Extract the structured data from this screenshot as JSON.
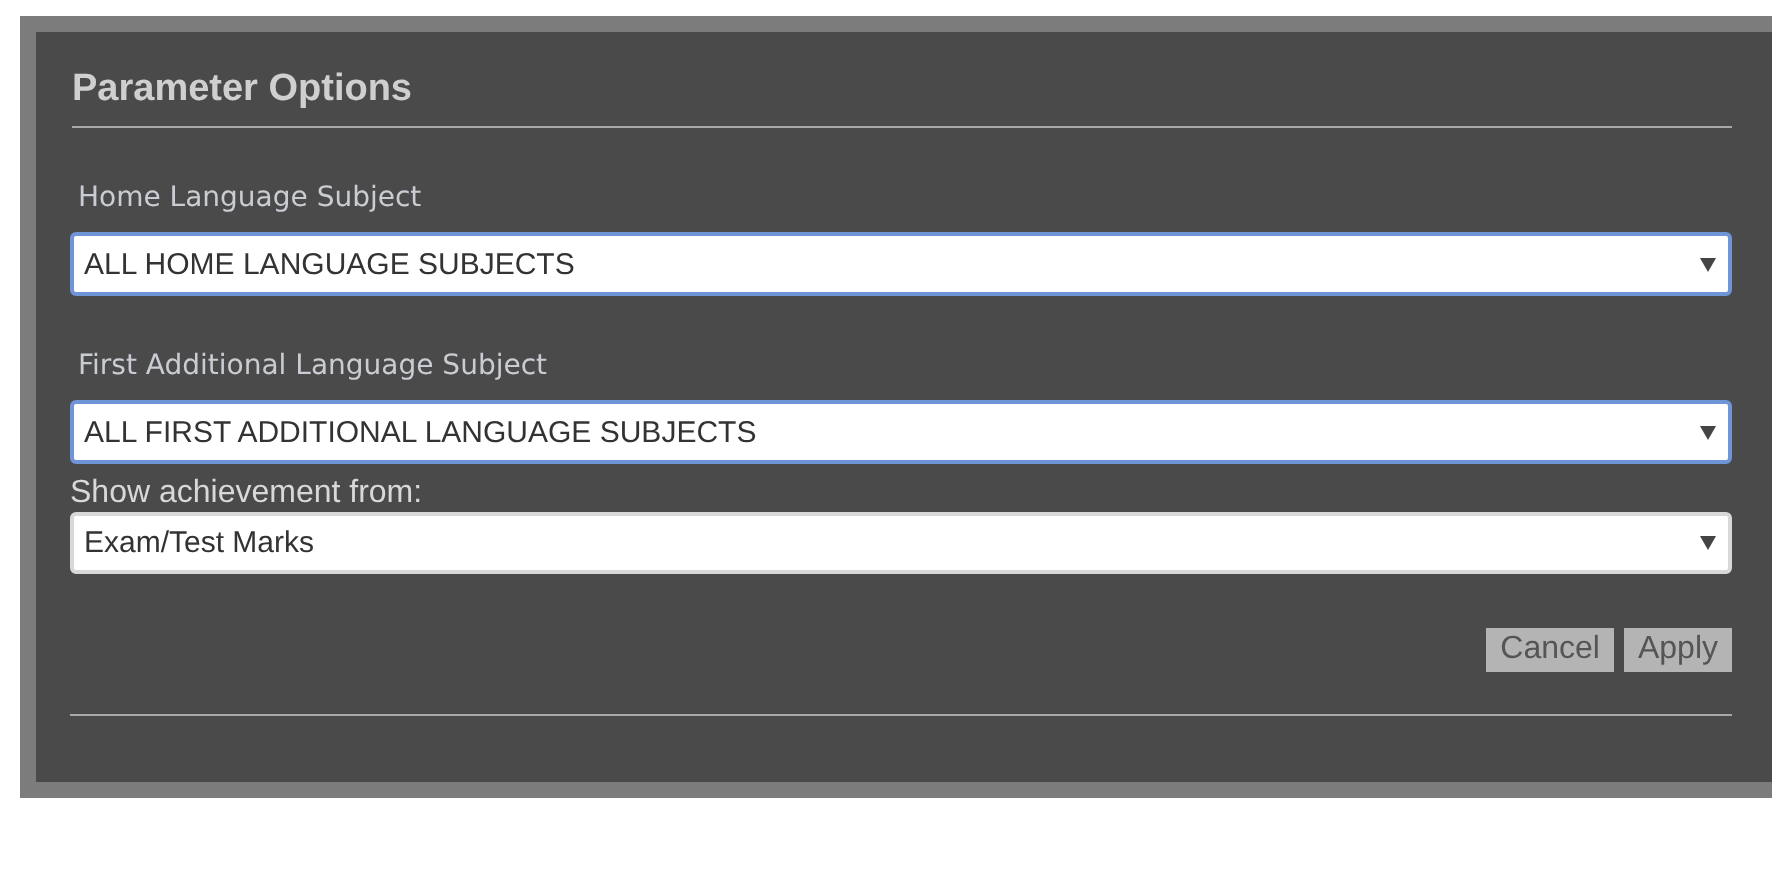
{
  "dialog": {
    "title": "Parameter Options",
    "fields": [
      {
        "label": "Home Language Subject",
        "value": "ALL HOME LANGUAGE SUBJECTS",
        "focused": true,
        "kind": "styled"
      },
      {
        "label": "First Additional Language Subject",
        "value": "ALL FIRST ADDITIONAL LANGUAGE SUBJECTS",
        "focused": true,
        "kind": "styled"
      },
      {
        "label": "Show achievement from:",
        "value": "Exam/Test Marks",
        "focused": false,
        "kind": "plain"
      }
    ],
    "buttons": [
      "Cancel",
      "Apply"
    ]
  }
}
